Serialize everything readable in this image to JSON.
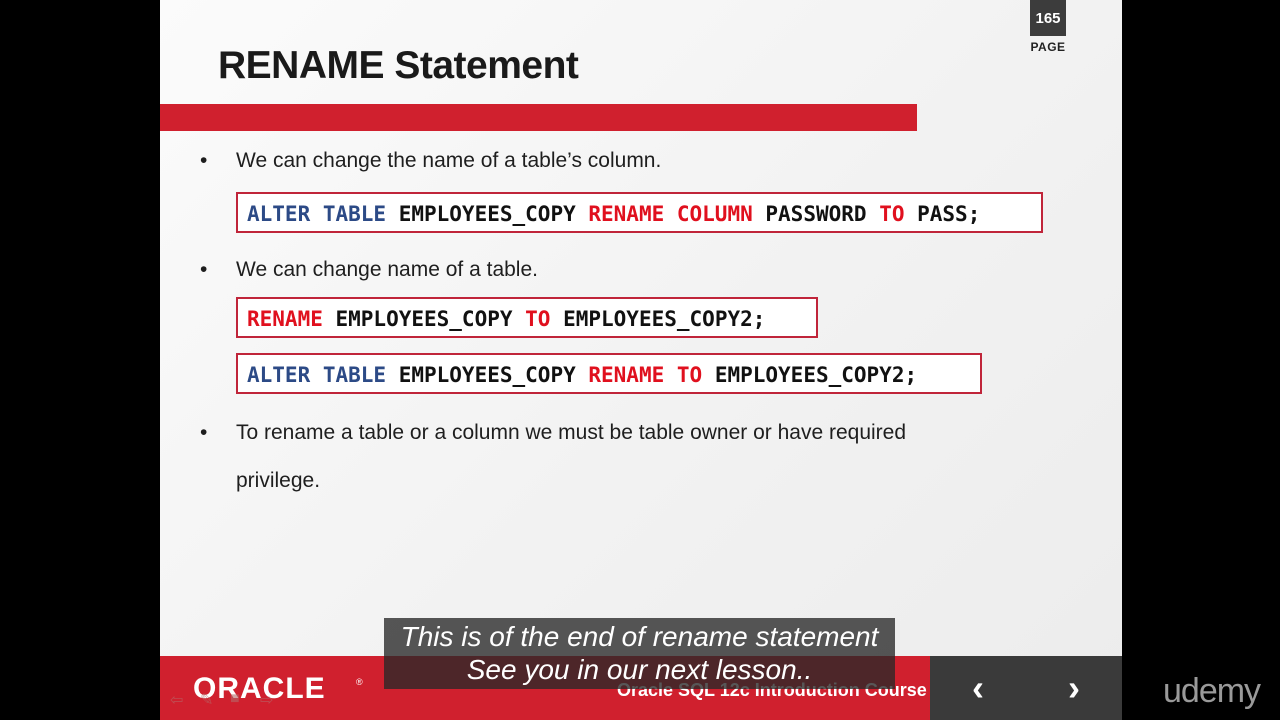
{
  "slide": {
    "page_number": "165",
    "page_label": "PAGE",
    "title": "RENAME Statement",
    "bullets": [
      "We can change the name of a table’s column.",
      "We can change name of a table.",
      "To rename a table or a column we must be table owner or have required",
      "privilege."
    ],
    "code": [
      [
        {
          "t": "ALTER TABLE",
          "c": "blue"
        },
        {
          "t": " EMPLOYEES_COPY ",
          "c": "plain"
        },
        {
          "t": "RENAME COLUMN",
          "c": "red"
        },
        {
          "t": " PASSWORD ",
          "c": "plain"
        },
        {
          "t": "TO",
          "c": "red"
        },
        {
          "t": " PASS;",
          "c": "plain"
        }
      ],
      [
        {
          "t": "RENAME",
          "c": "red"
        },
        {
          "t": " EMPLOYEES_COPY ",
          "c": "plain"
        },
        {
          "t": "TO",
          "c": "red"
        },
        {
          "t": " EMPLOYEES_COPY2;",
          "c": "plain"
        }
      ],
      [
        {
          "t": "ALTER TABLE",
          "c": "blue"
        },
        {
          "t": " EMPLOYEES_COPY ",
          "c": "plain"
        },
        {
          "t": "RENAME TO",
          "c": "red"
        },
        {
          "t": " EMPLOYEES_COPY2;",
          "c": "plain"
        }
      ]
    ],
    "footer": {
      "logo": "ORACLE",
      "logo_mark": "®",
      "course": "Oracle SQL 12c Introduction Course",
      "prev_icon": "‹",
      "next_icon": "›"
    }
  },
  "subtitles": {
    "line1": "This is of the end of rename statement",
    "line2": "See you in our next lesson.."
  },
  "brand": "udemy",
  "colors": {
    "accent_red": "#d0202e",
    "keyword_blue": "#2c4a86",
    "keyword_red": "#e0101e"
  }
}
